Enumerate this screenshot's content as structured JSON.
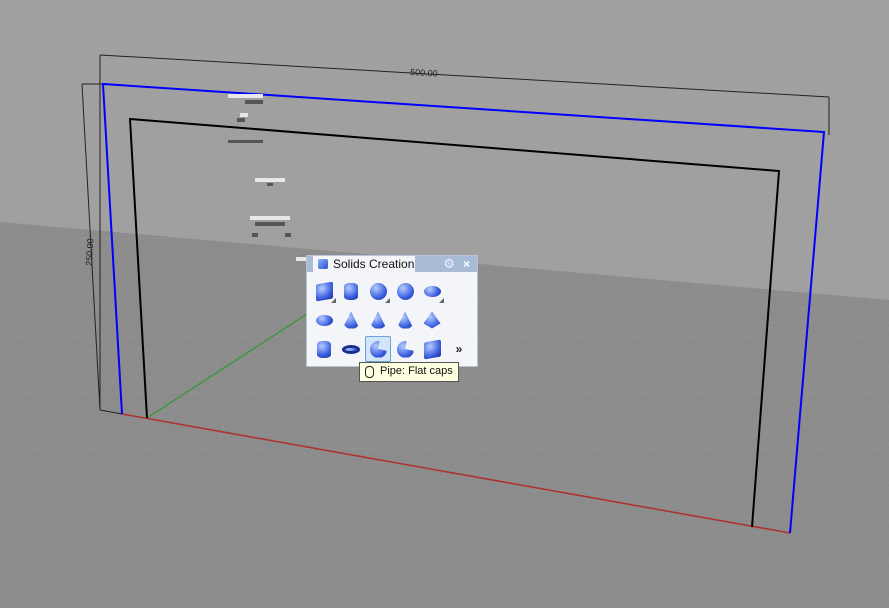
{
  "viewport": {
    "dimension_horizontal": "500.00",
    "dimension_vertical": "250.00",
    "colors": {
      "background": "#a0a0a0",
      "floor": "#8e8e8e",
      "x_axis": "#b03030",
      "y_axis": "#2f9a2f",
      "selection": "#0000ff"
    }
  },
  "panel": {
    "title": "Solids Creation",
    "settings_icon": "gear-icon",
    "close_label": "×",
    "buttons": [
      {
        "name": "box",
        "flyout": true,
        "shape": "box"
      },
      {
        "name": "cylinder",
        "flyout": false,
        "shape": "cylinder"
      },
      {
        "name": "sphere",
        "flyout": true,
        "shape": "sphere"
      },
      {
        "name": "sphere-3pt",
        "flyout": false,
        "shape": "sphere"
      },
      {
        "name": "ellipsoid",
        "flyout": true,
        "shape": "ellipsoid"
      },
      {
        "name": "paraboloid",
        "flyout": false,
        "shape": "ellipsoid"
      },
      {
        "name": "cone",
        "flyout": false,
        "shape": "cone"
      },
      {
        "name": "cone-solid",
        "flyout": false,
        "shape": "cone"
      },
      {
        "name": "truncated-cone",
        "flyout": false,
        "shape": "cone"
      },
      {
        "name": "pyramid",
        "flyout": false,
        "shape": "pyramid"
      },
      {
        "name": "tube",
        "flyout": false,
        "shape": "cylinder"
      },
      {
        "name": "torus",
        "flyout": false,
        "shape": "torus"
      },
      {
        "name": "pipe-flat-caps",
        "flyout": false,
        "shape": "pipe",
        "active": true
      },
      {
        "name": "pipe-round-caps",
        "flyout": false,
        "shape": "pipe"
      },
      {
        "name": "extrude",
        "flyout": false,
        "shape": "box"
      }
    ],
    "more_label": "»"
  },
  "tooltip": {
    "text": "Pipe: Flat caps"
  }
}
